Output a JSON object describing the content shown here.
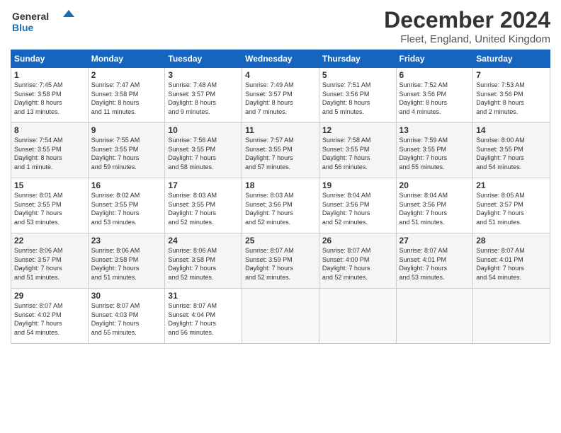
{
  "logo": {
    "line1": "General",
    "line2": "Blue"
  },
  "title": "December 2024",
  "subtitle": "Fleet, England, United Kingdom",
  "header_days": [
    "Sunday",
    "Monday",
    "Tuesday",
    "Wednesday",
    "Thursday",
    "Friday",
    "Saturday"
  ],
  "weeks": [
    [
      {
        "day": "1",
        "info": "Sunrise: 7:45 AM\nSunset: 3:58 PM\nDaylight: 8 hours\nand 13 minutes."
      },
      {
        "day": "2",
        "info": "Sunrise: 7:47 AM\nSunset: 3:58 PM\nDaylight: 8 hours\nand 11 minutes."
      },
      {
        "day": "3",
        "info": "Sunrise: 7:48 AM\nSunset: 3:57 PM\nDaylight: 8 hours\nand 9 minutes."
      },
      {
        "day": "4",
        "info": "Sunrise: 7:49 AM\nSunset: 3:57 PM\nDaylight: 8 hours\nand 7 minutes."
      },
      {
        "day": "5",
        "info": "Sunrise: 7:51 AM\nSunset: 3:56 PM\nDaylight: 8 hours\nand 5 minutes."
      },
      {
        "day": "6",
        "info": "Sunrise: 7:52 AM\nSunset: 3:56 PM\nDaylight: 8 hours\nand 4 minutes."
      },
      {
        "day": "7",
        "info": "Sunrise: 7:53 AM\nSunset: 3:56 PM\nDaylight: 8 hours\nand 2 minutes."
      }
    ],
    [
      {
        "day": "8",
        "info": "Sunrise: 7:54 AM\nSunset: 3:55 PM\nDaylight: 8 hours\nand 1 minute."
      },
      {
        "day": "9",
        "info": "Sunrise: 7:55 AM\nSunset: 3:55 PM\nDaylight: 7 hours\nand 59 minutes."
      },
      {
        "day": "10",
        "info": "Sunrise: 7:56 AM\nSunset: 3:55 PM\nDaylight: 7 hours\nand 58 minutes."
      },
      {
        "day": "11",
        "info": "Sunrise: 7:57 AM\nSunset: 3:55 PM\nDaylight: 7 hours\nand 57 minutes."
      },
      {
        "day": "12",
        "info": "Sunrise: 7:58 AM\nSunset: 3:55 PM\nDaylight: 7 hours\nand 56 minutes."
      },
      {
        "day": "13",
        "info": "Sunrise: 7:59 AM\nSunset: 3:55 PM\nDaylight: 7 hours\nand 55 minutes."
      },
      {
        "day": "14",
        "info": "Sunrise: 8:00 AM\nSunset: 3:55 PM\nDaylight: 7 hours\nand 54 minutes."
      }
    ],
    [
      {
        "day": "15",
        "info": "Sunrise: 8:01 AM\nSunset: 3:55 PM\nDaylight: 7 hours\nand 53 minutes."
      },
      {
        "day": "16",
        "info": "Sunrise: 8:02 AM\nSunset: 3:55 PM\nDaylight: 7 hours\nand 53 minutes."
      },
      {
        "day": "17",
        "info": "Sunrise: 8:03 AM\nSunset: 3:55 PM\nDaylight: 7 hours\nand 52 minutes."
      },
      {
        "day": "18",
        "info": "Sunrise: 8:03 AM\nSunset: 3:56 PM\nDaylight: 7 hours\nand 52 minutes."
      },
      {
        "day": "19",
        "info": "Sunrise: 8:04 AM\nSunset: 3:56 PM\nDaylight: 7 hours\nand 52 minutes."
      },
      {
        "day": "20",
        "info": "Sunrise: 8:04 AM\nSunset: 3:56 PM\nDaylight: 7 hours\nand 51 minutes."
      },
      {
        "day": "21",
        "info": "Sunrise: 8:05 AM\nSunset: 3:57 PM\nDaylight: 7 hours\nand 51 minutes."
      }
    ],
    [
      {
        "day": "22",
        "info": "Sunrise: 8:06 AM\nSunset: 3:57 PM\nDaylight: 7 hours\nand 51 minutes."
      },
      {
        "day": "23",
        "info": "Sunrise: 8:06 AM\nSunset: 3:58 PM\nDaylight: 7 hours\nand 51 minutes."
      },
      {
        "day": "24",
        "info": "Sunrise: 8:06 AM\nSunset: 3:58 PM\nDaylight: 7 hours\nand 52 minutes."
      },
      {
        "day": "25",
        "info": "Sunrise: 8:07 AM\nSunset: 3:59 PM\nDaylight: 7 hours\nand 52 minutes."
      },
      {
        "day": "26",
        "info": "Sunrise: 8:07 AM\nSunset: 4:00 PM\nDaylight: 7 hours\nand 52 minutes."
      },
      {
        "day": "27",
        "info": "Sunrise: 8:07 AM\nSunset: 4:01 PM\nDaylight: 7 hours\nand 53 minutes."
      },
      {
        "day": "28",
        "info": "Sunrise: 8:07 AM\nSunset: 4:01 PM\nDaylight: 7 hours\nand 54 minutes."
      }
    ],
    [
      {
        "day": "29",
        "info": "Sunrise: 8:07 AM\nSunset: 4:02 PM\nDaylight: 7 hours\nand 54 minutes."
      },
      {
        "day": "30",
        "info": "Sunrise: 8:07 AM\nSunset: 4:03 PM\nDaylight: 7 hours\nand 55 minutes."
      },
      {
        "day": "31",
        "info": "Sunrise: 8:07 AM\nSunset: 4:04 PM\nDaylight: 7 hours\nand 56 minutes."
      },
      {
        "day": "",
        "info": ""
      },
      {
        "day": "",
        "info": ""
      },
      {
        "day": "",
        "info": ""
      },
      {
        "day": "",
        "info": ""
      }
    ]
  ]
}
